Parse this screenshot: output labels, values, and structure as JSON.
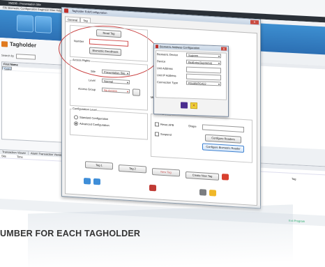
{
  "app": {
    "title": "XM238 - Presentation Site",
    "menu": "File  Biometric  Configuration  Engineer  Man  Help  Teams"
  },
  "left_panel": {
    "heading": "Tagholder",
    "search_label": "Search by",
    "list": {
      "header": "First Name",
      "items": [
        "Sales",
        "Stels"
      ]
    }
  },
  "right_panel": {
    "header": "Department"
  },
  "bottom_panel": {
    "tabs": [
      "Transaction Viewer",
      "Alarm Transaction Viewer",
      "Co"
    ],
    "columns": [
      "Site",
      "Time"
    ],
    "tag_col": "Tag"
  },
  "exit_label": "Exit Program",
  "dialog": {
    "title": "Tagholder Edit/Configuration",
    "close": "X",
    "tabs": [
      "General",
      "Tag"
    ],
    "read_tag": "Read Tag",
    "number_label": "Number",
    "biometric_enrollment": "Biometric Enrollment",
    "access_rights": {
      "title": "Access Rights",
      "site_label": "Site",
      "site_value": "Presentation Site",
      "level_label": "Level",
      "level_value": "Normal",
      "group_label": "Access Group",
      "group_value": "No Access"
    },
    "config_level": {
      "title": "Configuration Level",
      "options": [
        "Standard Configuration",
        "Advanced Configuration"
      ],
      "selected": 1
    },
    "misc": {
      "title": "Miscellaneous",
      "reset_apb": "Reset APB",
      "shape_label": "Shape",
      "suspend": "Suspend",
      "configure_readers": "Configure Readers",
      "configure_biometric": "Configure Biometric Reader"
    },
    "mini_label": "Mi",
    "footer": {
      "tag1": "Tag 1",
      "tag2": "Tag 2",
      "new_tag": "New Tag",
      "create_new_tag": "Create New Tag"
    }
  },
  "biometric_config": {
    "title": "Biometric Address Configuration",
    "close": "X",
    "rows": [
      {
        "label": "Biometric Device",
        "value": "Suprem"
      },
      {
        "label": "Device",
        "value": "BioEntry(Suprema)"
      },
      {
        "label": "Unit Address",
        "value": ""
      },
      {
        "label": "Unit IP Address",
        "value": ""
      },
      {
        "label": "Connection Type",
        "value": "RS485/RS422"
      }
    ]
  },
  "caption": "UMBER FOR EACH TAGHOLDER"
}
